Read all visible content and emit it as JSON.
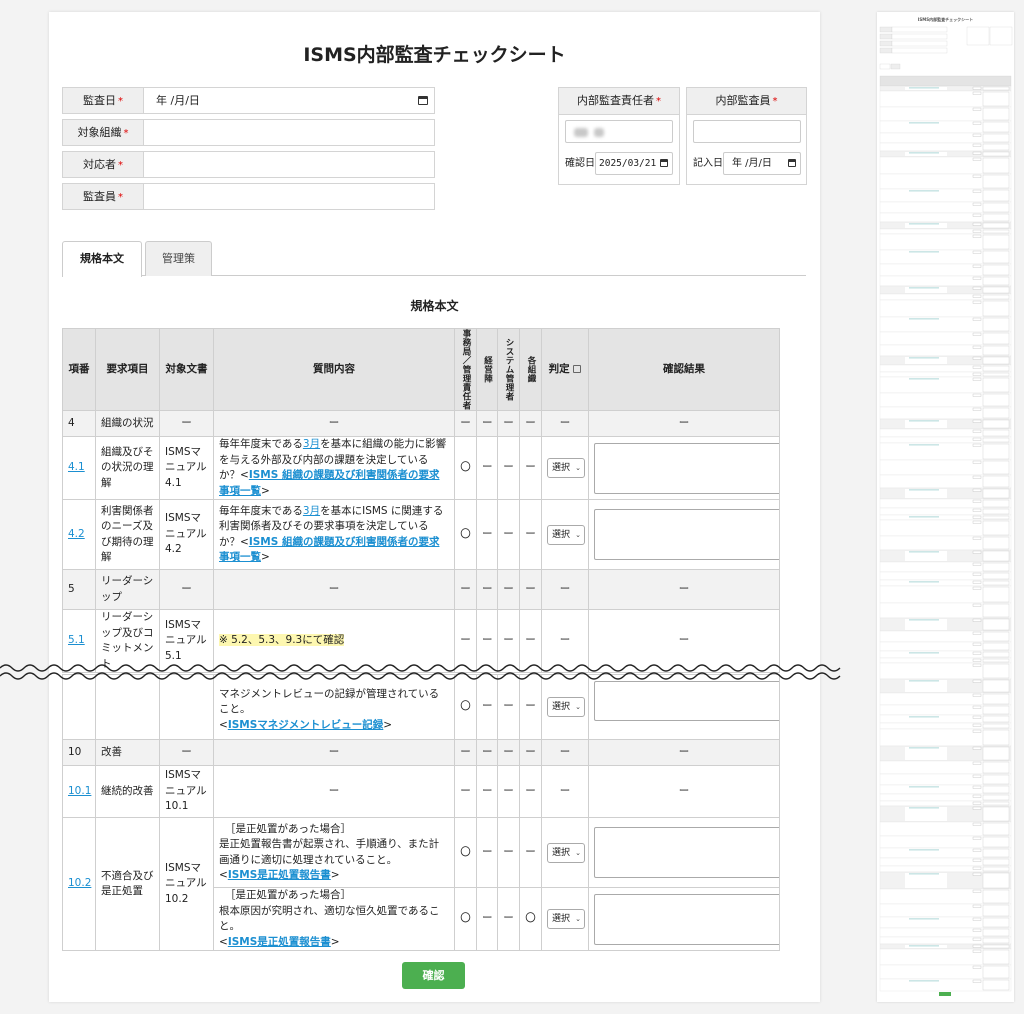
{
  "page": {
    "title": "ISMS内部監査チェックシート"
  },
  "form": {
    "audit_date": {
      "label": "監査日",
      "value": "年 /月/日"
    },
    "target_org": {
      "label": "対象組織",
      "value": ""
    },
    "respondent": {
      "label": "対応者",
      "value": ""
    },
    "auditor": {
      "label": "監査員",
      "value": ""
    },
    "required_mark": "*"
  },
  "responsible": {
    "head": "内部監査責任者",
    "confirm_label": "確認日",
    "confirm_date": "2025/03/21"
  },
  "internal_auditor": {
    "head": "内部監査員",
    "entry_label": "記入日",
    "entry_date": "年 /月/日"
  },
  "tabs": [
    {
      "label": "規格本文",
      "active": true
    },
    {
      "label": "管理策",
      "active": false
    }
  ],
  "section_title": "規格本文",
  "table": {
    "headers": {
      "no": "項番",
      "req": "要求項目",
      "doc": "対象文書",
      "q": "質問内容",
      "r1": "事務局／管理責任者",
      "r2": "経営陣",
      "r3": "システム管理者",
      "r4": "各組織",
      "judge": "判定",
      "result": "確認結果"
    },
    "dash": "ー",
    "circle": "〇",
    "select_label": "選択",
    "rows_top": {
      "r4": {
        "no": "4",
        "req": "組織の状況"
      },
      "r41": {
        "no": "4.1",
        "req": "組織及びその状況の理解",
        "doc": "ISMSマニュアル4.1",
        "q_pre": "毎年年度末である",
        "q_link": "3月",
        "q_mid": "を基本に組織の能力に影響を与える外部及び内部の課題を決定しているか？<",
        "q_link2": "ISMS 組織の課題及び利害関係者の要求事項一覧",
        "q_end": ">"
      },
      "r42": {
        "no": "4.2",
        "req": "利害関係者のニーズ及び期待の理解",
        "doc": "ISMSマニュアル4.2",
        "q_pre": "毎年年度末である",
        "q_link": "3月",
        "q_mid": "を基本にISMS に関連する利害関係者及びその要求事項を決定しているか？<",
        "q_link2": "ISMS 組織の課題及び利害関係者の要求事項一覧",
        "q_end": ">"
      },
      "r5": {
        "no": "5",
        "req": "リーダーシップ"
      },
      "r51": {
        "no": "5.1",
        "req": "リーダーシップ及びコミットメント",
        "doc": "ISMSマニュアル5.1",
        "q": "※ 5.2、5.3、9.3にて確認"
      }
    },
    "rows_bottom": {
      "cont": {
        "q": "マネジメントレビューの記録が管理されていること。",
        "q_pre": "<",
        "q_link": "ISMSマネジメントレビュー記録",
        "q_end": ">"
      },
      "r10": {
        "no": "10",
        "req": "改善"
      },
      "r101": {
        "no": "10.1",
        "req": "継続的改善",
        "doc": "ISMSマニュアル10.1"
      },
      "r102": {
        "no": "10.2",
        "req": "不適合及び是正処置",
        "doc": "ISMSマニュアル10.2",
        "a_cond": "［是正処置があった場合］",
        "a_text": "是正処置報告書が起票され、手順通り、また計画通りに適切に処理されていること。",
        "a_pre": "<",
        "a_link": "ISMS是正処置報告書",
        "a_end": ">",
        "b_cond": "［是正処置があった場合］",
        "b_text": "根本原因が究明され、適切な恒久処置であること。",
        "b_pre": "<",
        "b_link": "ISMS是正処置報告書",
        "b_end": ">"
      }
    }
  },
  "confirm_button": "確認"
}
